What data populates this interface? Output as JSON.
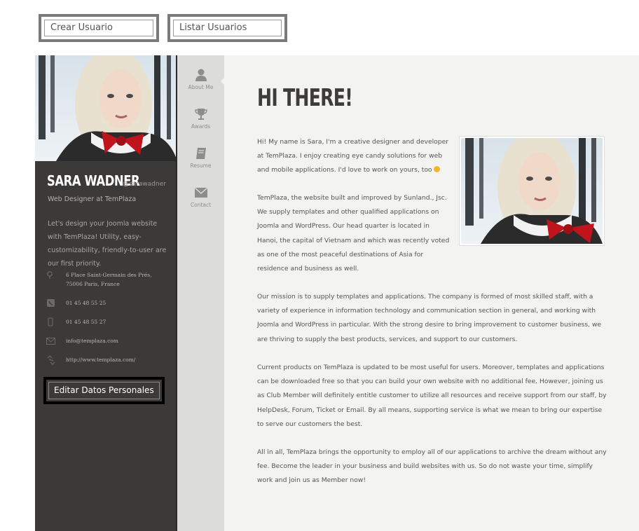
{
  "toolbar": {
    "create_user_label": "Crear Usuario",
    "list_users_label": "Listar Usuarios"
  },
  "profile": {
    "name": "SARA WADNER",
    "handle": "@sarawadner",
    "role": "Web Designer at TemPlaza",
    "bio": "Let's design your Joomla website with TemPlaza! Utility, easy-customizability, friendly-to-user are our first priority.",
    "contacts": [
      {
        "icon": "location-icon",
        "text": "6 Place Saint-Germain des Prés, 75006 Paris, France"
      },
      {
        "icon": "phone-icon",
        "text": "01 45 48 55 25"
      },
      {
        "icon": "mobile-icon",
        "text": "01 45 48 55 27"
      },
      {
        "icon": "mail-icon",
        "text": "info@templaza.com"
      },
      {
        "icon": "link-icon",
        "text": "http://www.templaza.com/"
      }
    ],
    "edit_button_label": "Editar Datos Personales"
  },
  "nav": {
    "items": [
      {
        "icon": "user-icon",
        "label": "About Me"
      },
      {
        "icon": "trophy-icon",
        "label": "Awards"
      },
      {
        "icon": "book-icon",
        "label": "Resume"
      },
      {
        "icon": "envelope-icon",
        "label": "Contact"
      }
    ]
  },
  "content": {
    "title": "HI THERE!",
    "paragraphs": [
      "Hi! My name is Sara, I'm a creative designer and developer at TemPlaza. I enjoy creating eye candy solutions for web and mobile applications. I'd love to work on yours, too",
      "TemPlaza, the website built and improved by Sunland., Jsc. We supply templates and other qualified applications on Joomla and WordPress. Our head quarter is located in Hanoi, the capital of Vietnam and which was recently voted as one of the most peaceful destinations of Asia for residence and business as well.",
      "Our mission is to supply templates and applications. The company is formed of most skilled staff, with a variety of experience in information technology and communication section in general, and working with Joomla and WordPress in particular. With the strong desire to bring improvement to customer business, we are thriving to supply the best products, services, and support to our customers.",
      "Current products on TemPlaza is updated to be most useful for users. Moreover, templates and applications can be downloaded free so that you can build your own website with no additional fee. However, joining us as Club Member will definitely entitle customer to utilize all resources and receive support from our staff, by HelpDesk, Forum, Ticket or Email. By all means, supporting service is what we mean to bring our expertise to serve our customers the best.",
      "All in all, TemPlaza brings the opportunity to employ all of our applications to archive the dream without any fee. Become the leader in your business and build websites with us. So do not waste your time, simplify work and join us as Member now!"
    ]
  },
  "colors": {
    "sidebar_bg": "#3b3a38",
    "nav_bg": "#dcdddb",
    "content_bg": "#f3f3f1",
    "accent_red": "#c0141d"
  }
}
